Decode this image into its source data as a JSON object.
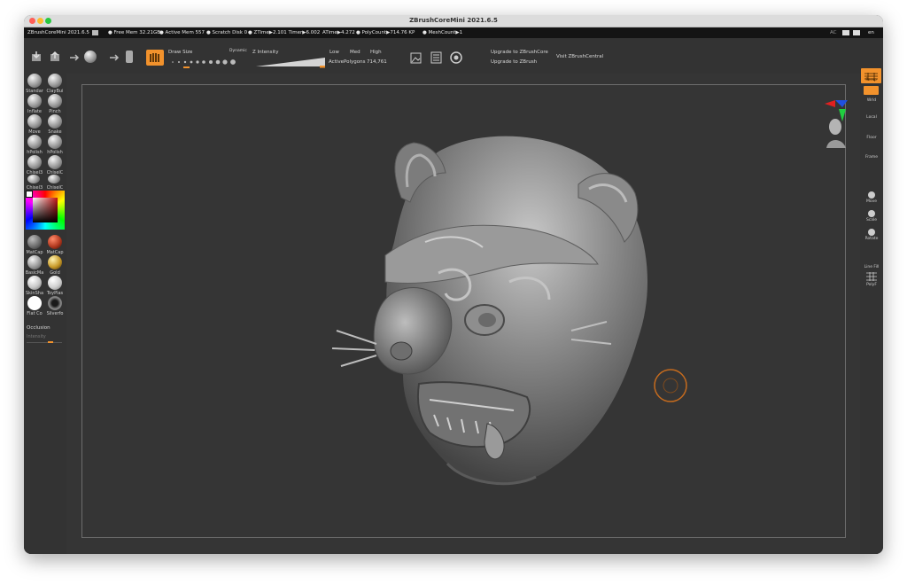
{
  "window": {
    "title": "ZBrushCoreMini 2021.6.5"
  },
  "statusbar": {
    "app": "ZBrushCoreMini 2021.6.5",
    "free_mem": "● Free Mem 32.21GB",
    "active_mem": "● Active Mem 557",
    "scratch": "● Scratch Disk 0",
    "ztime": "● ZTime▶2.101 Timer▶6.002",
    "atime": "ATime▶4.272",
    "polycount": "● PolyCount▶714.76 KP",
    "meshcount": "● MeshCount▶1",
    "ac": "AC",
    "menu_en": "en"
  },
  "toolbar": {
    "draw_size_label": "Draw Size",
    "dynamic_label": "Dynamic",
    "z_intensity_label": "Z Intensity",
    "low_label": "Low",
    "med_label": "Med",
    "high_label": "High",
    "active_polygons_label": "ActivePolygons",
    "active_polygons_value": "714,761",
    "upgrade_core": "Upgrade to ZBrushCore",
    "upgrade_zbrush": "Upgrade to ZBrush",
    "visit_central": "Visit ZBrushCentral"
  },
  "left_shelf": {
    "brushes": [
      {
        "name": "Standar"
      },
      {
        "name": "ClayBui"
      },
      {
        "name": "Inflate"
      },
      {
        "name": "Pinch"
      },
      {
        "name": "Move"
      },
      {
        "name": "Snake"
      },
      {
        "name": "hPolish"
      },
      {
        "name": "hPolish"
      },
      {
        "name": "Chisel3"
      },
      {
        "name": "ChiselC"
      },
      {
        "name": "Chisel3"
      },
      {
        "name": "ChiselC"
      }
    ],
    "materials": [
      {
        "name": "MatCap"
      },
      {
        "name": "MatCap"
      },
      {
        "name": "BasicMa"
      },
      {
        "name": "Gold"
      },
      {
        "name": "SkinSha"
      },
      {
        "name": "ToyPlas"
      },
      {
        "name": "Flat Co"
      },
      {
        "name": "Silverfo"
      }
    ],
    "occlusion_label": "Occlusion",
    "intensity_label": "Intensity"
  },
  "right_shelf": {
    "items": [
      "Persp",
      "Wrld",
      "Local",
      "Floor",
      "Frame",
      "Move",
      "Scale",
      "Rotate",
      "Line Fill",
      "PolyF"
    ]
  },
  "colors": {
    "accent": "#f2922c",
    "panel": "#333333",
    "canvas": "#353535",
    "statusbar": "#141414"
  }
}
